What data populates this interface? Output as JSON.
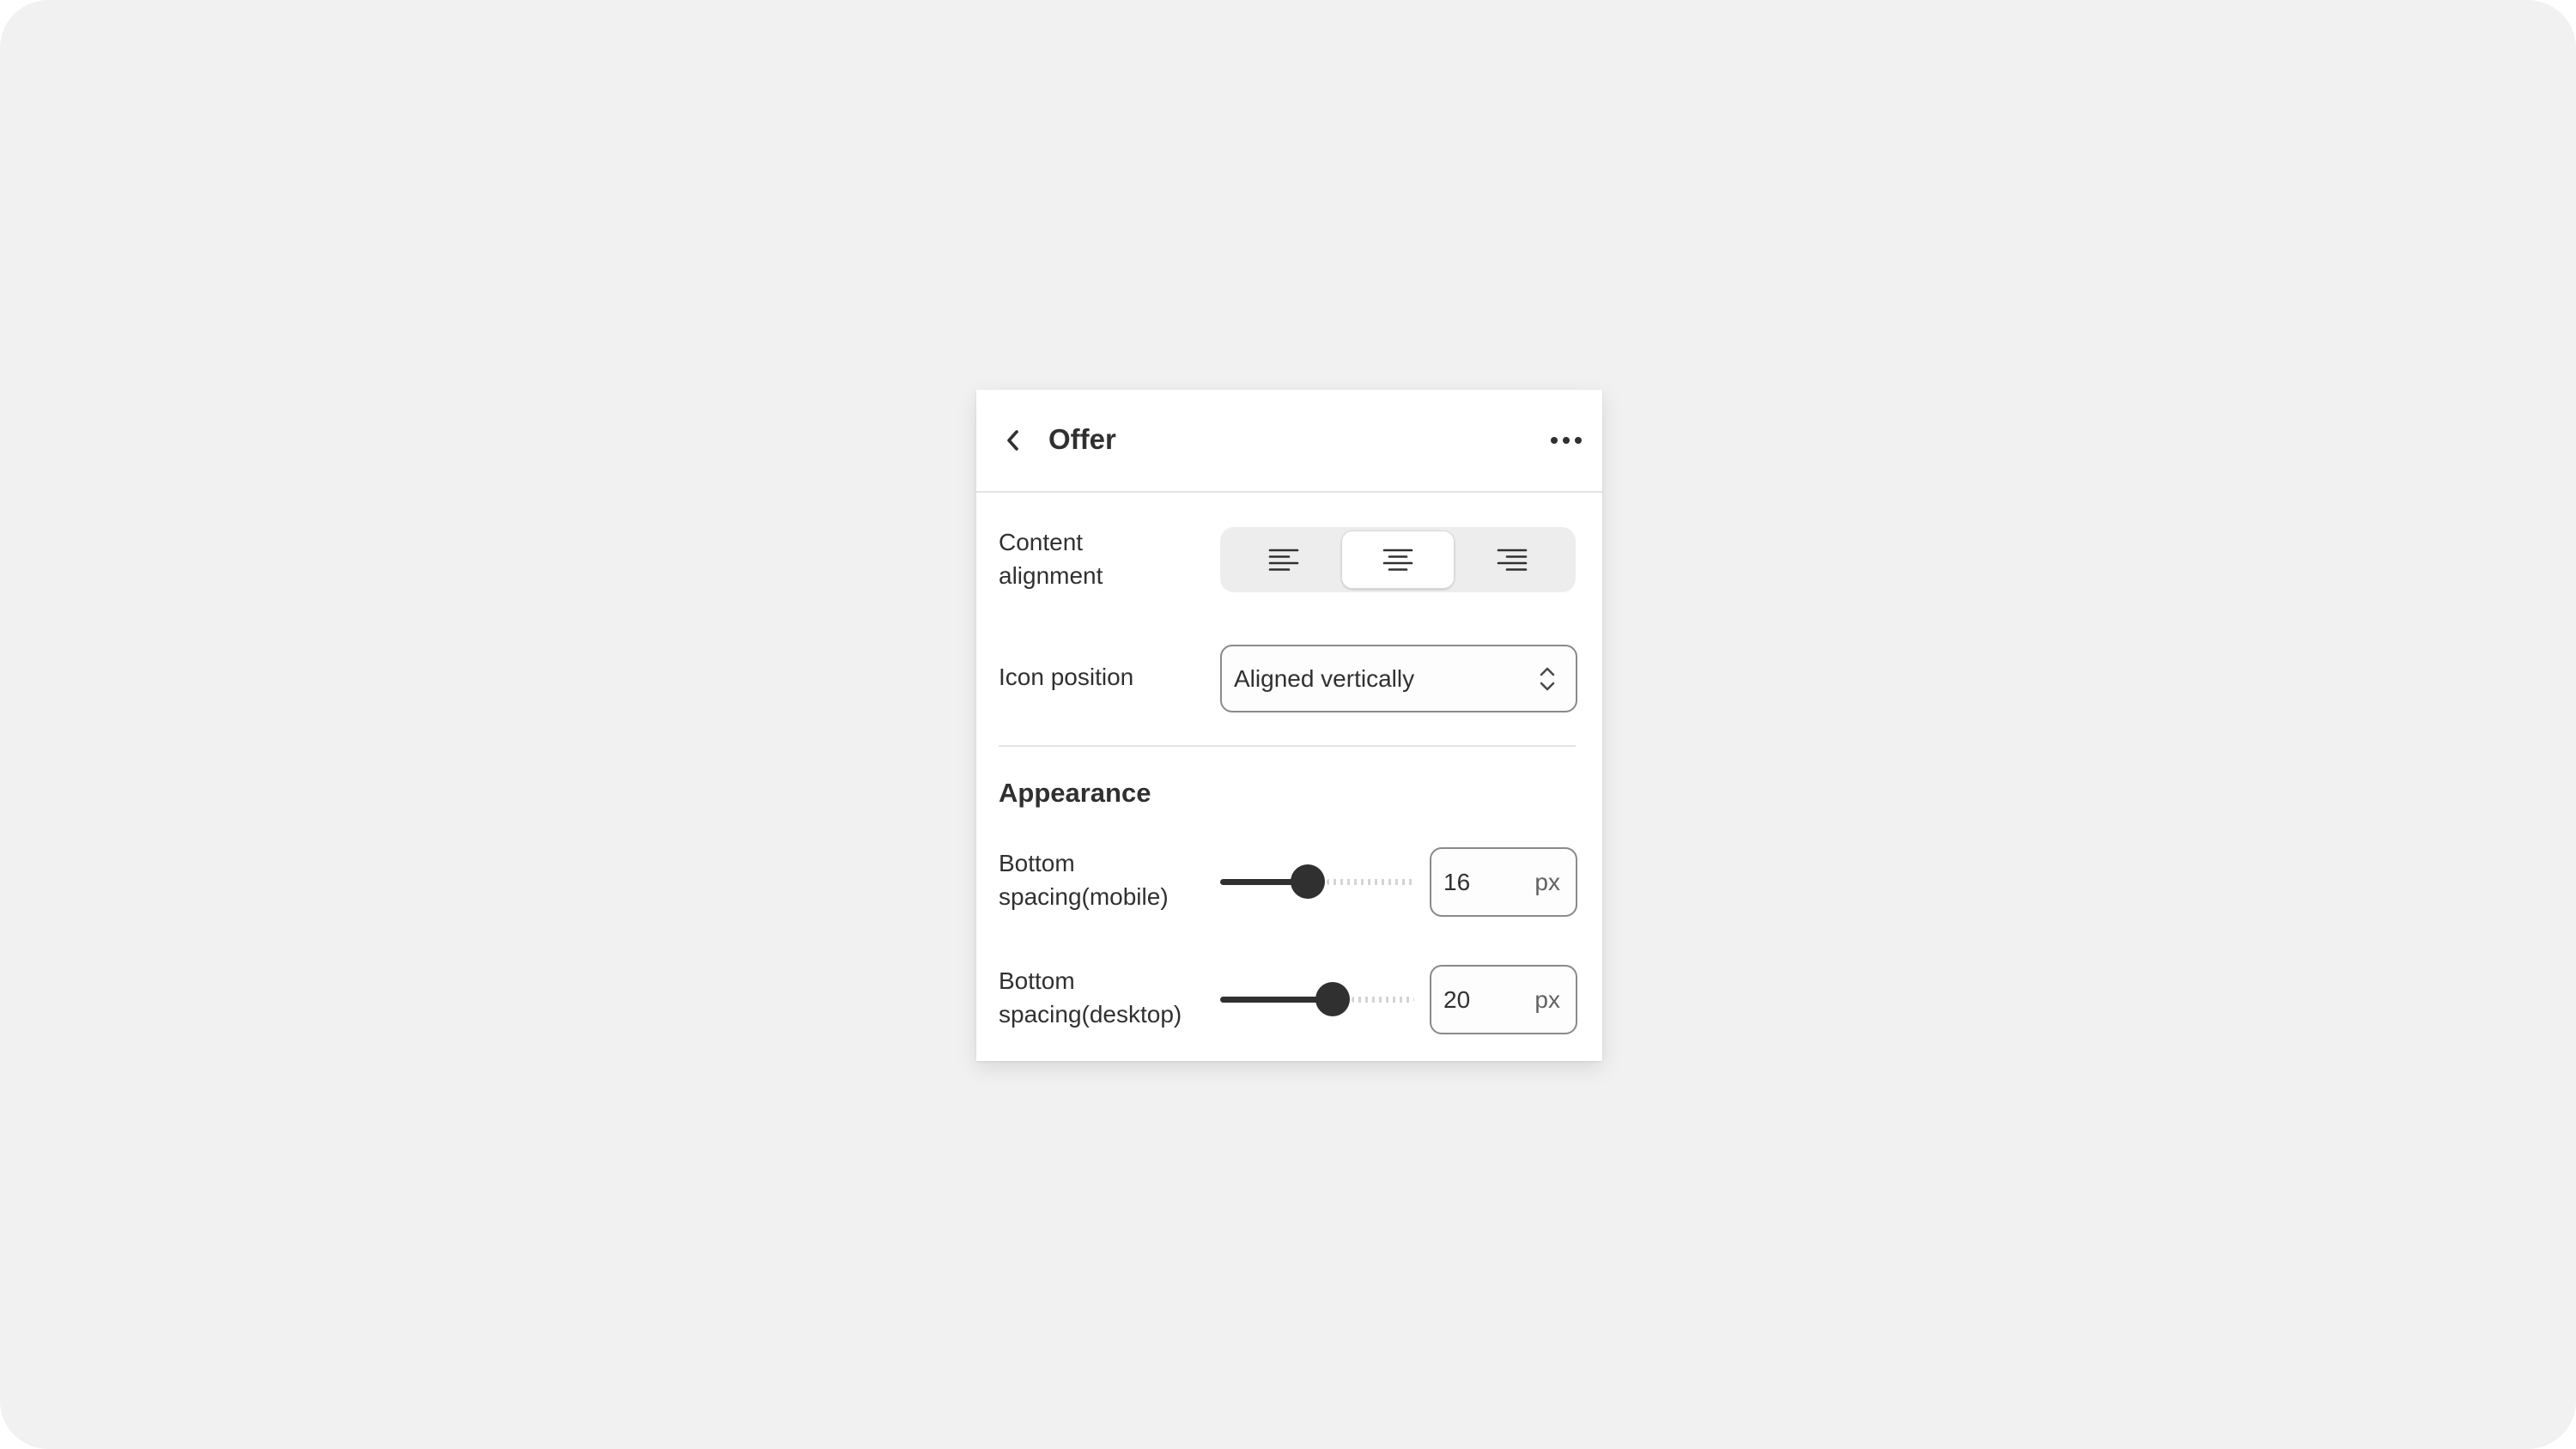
{
  "panel": {
    "title": "Offer",
    "back_icon": "chevron-left-icon",
    "more_icon": "ellipsis-horizontal-icon"
  },
  "content_alignment": {
    "label": "Content alignment",
    "label_lines": [
      "Content",
      "alignment"
    ],
    "options": [
      {
        "icon": "align-left-icon",
        "selected": false
      },
      {
        "icon": "align-center-icon",
        "selected": true
      },
      {
        "icon": "align-right-icon",
        "selected": false
      }
    ]
  },
  "icon_position": {
    "label": "Icon position",
    "value": "Aligned vertically",
    "chevron_icon": "select-chevron-icon"
  },
  "appearance": {
    "title": "Appearance",
    "bottom_spacing_mobile": {
      "label_lines": [
        "Bottom",
        "spacing(mobile)"
      ],
      "value": "16",
      "unit": "px",
      "slider_fraction": 0.45
    },
    "bottom_spacing_desktop": {
      "label_lines": [
        "Bottom",
        "spacing(desktop)"
      ],
      "value": "20",
      "unit": "px",
      "slider_fraction": 0.58
    }
  },
  "colors": {
    "background": "#f1f1f1",
    "panel": "#ffffff",
    "text": "#303030",
    "border": "#8a8a8a",
    "slider_fill": "#303030"
  }
}
